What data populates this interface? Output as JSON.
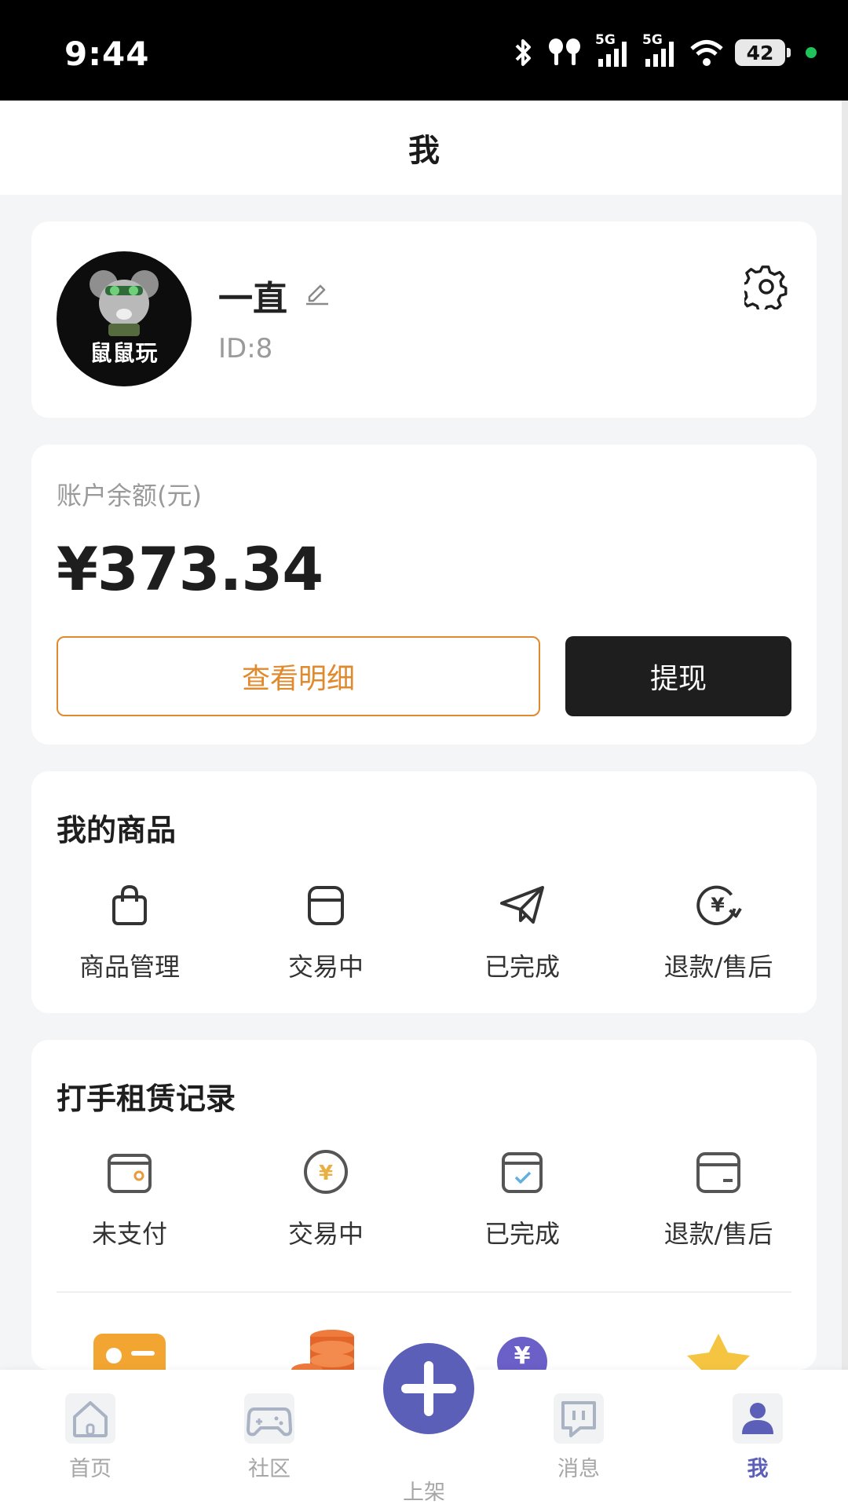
{
  "status_bar": {
    "time": "9:44",
    "network_label_1": "5G",
    "network_label_2": "5G",
    "battery": "42",
    "icons": [
      "bluetooth-icon",
      "earbuds-icon",
      "signal-icon",
      "signal-icon",
      "wifi-icon",
      "battery-icon"
    ]
  },
  "header": {
    "title": "我"
  },
  "profile": {
    "avatar_text": "鼠鼠玩",
    "name": "一直",
    "id": "ID:8"
  },
  "balance": {
    "label": "账户余额(元)",
    "amount": "¥373.34",
    "detail_button": "查看明细",
    "withdraw_button": "提现"
  },
  "goods": {
    "title": "我的商品",
    "items": [
      {
        "label": "商品管理",
        "icon": "shopping-bag-icon"
      },
      {
        "label": "交易中",
        "icon": "inbox-icon"
      },
      {
        "label": "已完成",
        "icon": "paper-plane-icon"
      },
      {
        "label": "退款/售后",
        "icon": "refund-yen-icon"
      }
    ]
  },
  "rental": {
    "title": "打手租赁记录",
    "items": [
      {
        "label": "未支付",
        "icon": "wallet-icon"
      },
      {
        "label": "交易中",
        "icon": "yen-coin-icon"
      },
      {
        "label": "已完成",
        "icon": "completed-box-icon"
      },
      {
        "label": "退款/售后",
        "icon": "card-icon"
      }
    ]
  },
  "colors": {
    "accent": "#5b5fb8",
    "orange": "#e08a2e",
    "dark": "#1e1e1e"
  },
  "nav": {
    "items": [
      {
        "label": "首页",
        "icon": "home-icon"
      },
      {
        "label": "社区",
        "icon": "gamepad-icon"
      },
      {
        "label": "上架",
        "icon": "plus-icon"
      },
      {
        "label": "消息",
        "icon": "message-icon"
      },
      {
        "label": "我",
        "icon": "user-icon"
      }
    ]
  }
}
